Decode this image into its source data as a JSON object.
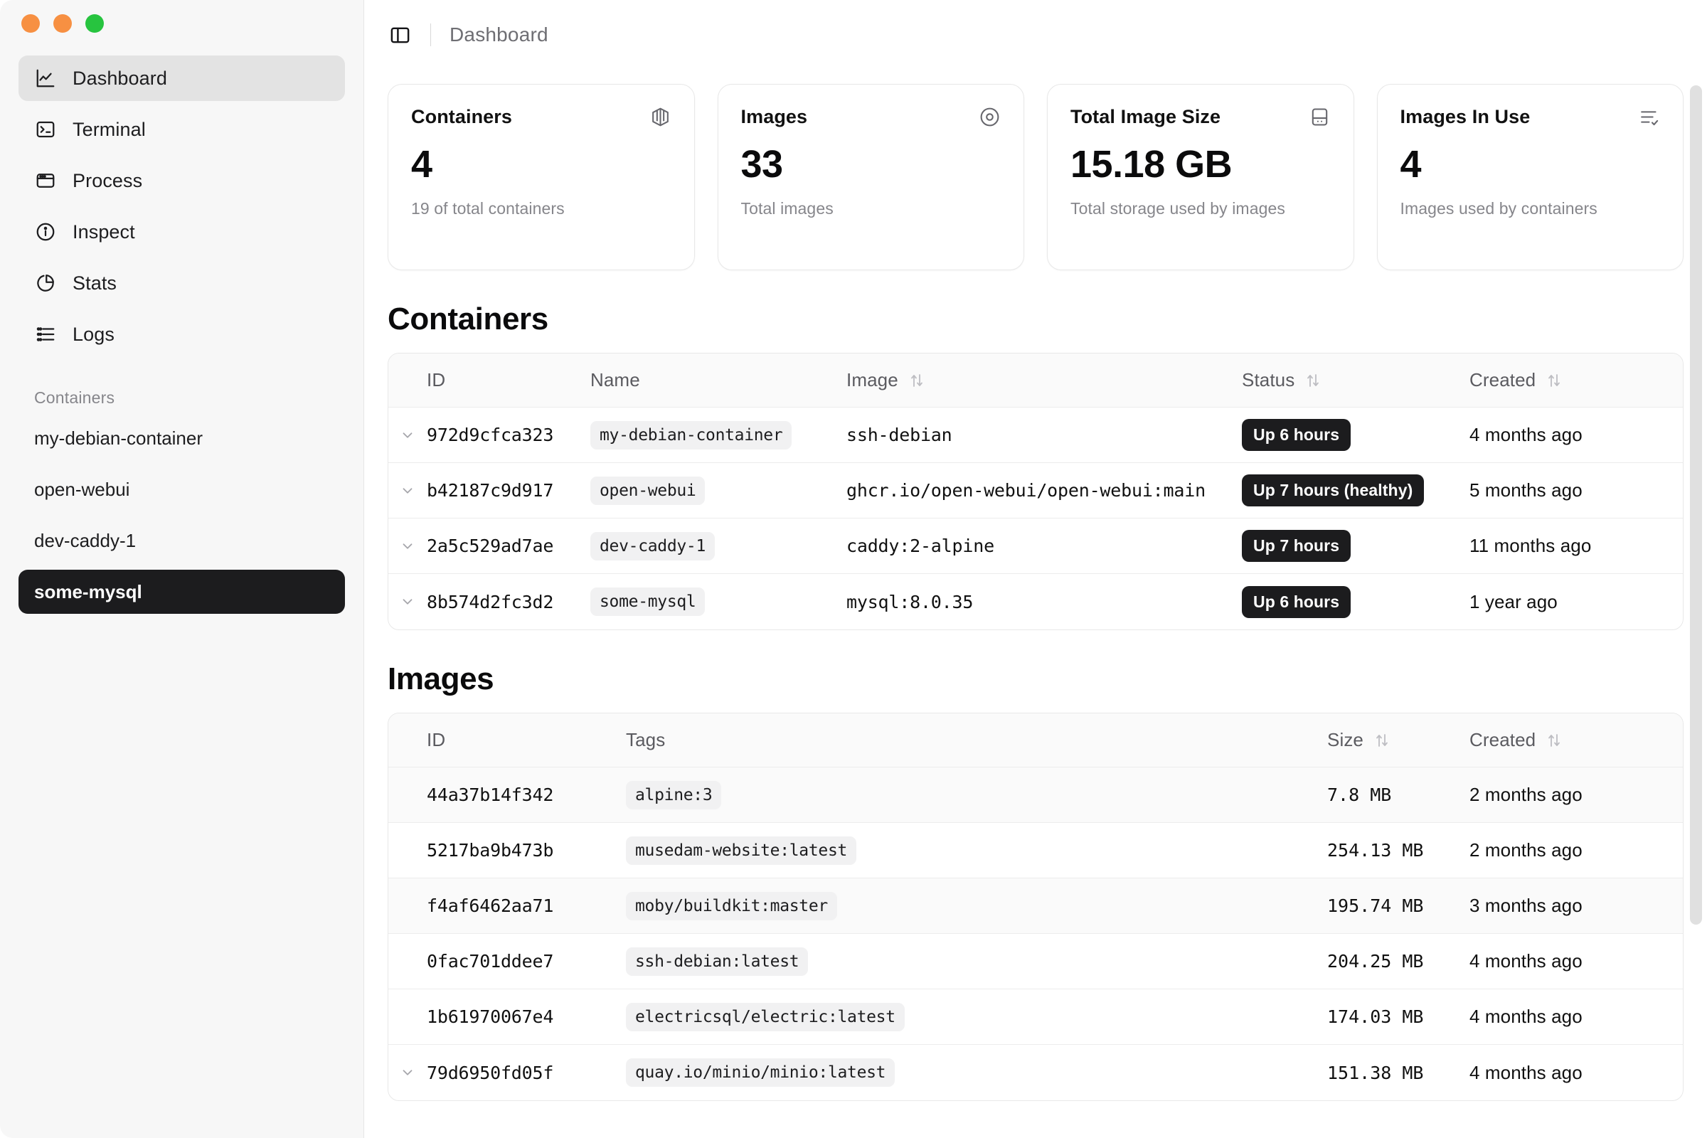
{
  "window": {
    "traffic_lights": [
      {
        "name": "close",
        "color": "#f79042"
      },
      {
        "name": "minimize",
        "color": "#f79042"
      },
      {
        "name": "maximize",
        "color": "#27c43f"
      }
    ]
  },
  "sidebar": {
    "nav": [
      {
        "label": "Dashboard",
        "icon": "chart-line-icon",
        "active": true
      },
      {
        "label": "Terminal",
        "icon": "terminal-icon",
        "active": false
      },
      {
        "label": "Process",
        "icon": "window-icon",
        "active": false
      },
      {
        "label": "Inspect",
        "icon": "info-circle-icon",
        "active": false
      },
      {
        "label": "Stats",
        "icon": "pie-chart-icon",
        "active": false
      },
      {
        "label": "Logs",
        "icon": "list-icon",
        "active": false
      }
    ],
    "section_label": "Containers",
    "containers": [
      {
        "label": "my-debian-container",
        "selected": false
      },
      {
        "label": "open-webui",
        "selected": false
      },
      {
        "label": "dev-caddy-1",
        "selected": false
      },
      {
        "label": "some-mysql",
        "selected": true
      }
    ]
  },
  "topbar": {
    "toggle_icon": "sidebar-toggle-icon",
    "breadcrumb": "Dashboard"
  },
  "cards": [
    {
      "title": "Containers",
      "icon": "box-3d-icon",
      "value": "4",
      "subtitle": "19 of total containers"
    },
    {
      "title": "Images",
      "icon": "disc-icon",
      "value": "33",
      "subtitle": "Total images"
    },
    {
      "title": "Total Image Size",
      "icon": "hard-drive-icon",
      "value": "15.18 GB",
      "subtitle": "Total storage used by images"
    },
    {
      "title": "Images In Use",
      "icon": "list-check-icon",
      "value": "4",
      "subtitle": "Images used by containers"
    }
  ],
  "containers_section": {
    "heading": "Containers",
    "columns": [
      "ID",
      "Name",
      "Image",
      "Status",
      "Created"
    ],
    "sortable": [
      false,
      false,
      true,
      true,
      true
    ],
    "rows": [
      {
        "id": "972d9cfca323",
        "name": "my-debian-container",
        "image": "ssh-debian",
        "status": "Up 6 hours",
        "created": "4 months ago",
        "expandable": true
      },
      {
        "id": "b42187c9d917",
        "name": "open-webui",
        "image": "ghcr.io/open-webui/open-webui:main",
        "status": "Up 7 hours (healthy)",
        "created": "5 months ago",
        "expandable": true
      },
      {
        "id": "2a5c529ad7ae",
        "name": "dev-caddy-1",
        "image": "caddy:2-alpine",
        "status": "Up 7 hours",
        "created": "11 months ago",
        "expandable": true
      },
      {
        "id": "8b574d2fc3d2",
        "name": "some-mysql",
        "image": "mysql:8.0.35",
        "status": "Up 6 hours",
        "created": "1 year ago",
        "expandable": true
      }
    ]
  },
  "images_section": {
    "heading": "Images",
    "columns": [
      "ID",
      "Tags",
      "Size",
      "Created"
    ],
    "sortable": [
      false,
      false,
      true,
      true
    ],
    "rows": [
      {
        "id": "44a37b14f342",
        "tag": "alpine:3",
        "size": "7.8 MB",
        "created": "2 months ago",
        "expandable": false
      },
      {
        "id": "5217ba9b473b",
        "tag": "musedam-website:latest",
        "size": "254.13 MB",
        "created": "2 months ago",
        "expandable": false
      },
      {
        "id": "f4af6462aa71",
        "tag": "moby/buildkit:master",
        "size": "195.74 MB",
        "created": "3 months ago",
        "expandable": false
      },
      {
        "id": "0fac701ddee7",
        "tag": "ssh-debian:latest",
        "size": "204.25 MB",
        "created": "4 months ago",
        "expandable": false
      },
      {
        "id": "1b61970067e4",
        "tag": "electricsql/electric:latest",
        "size": "174.03 MB",
        "created": "4 months ago",
        "expandable": false
      },
      {
        "id": "79d6950fd05f",
        "tag": "quay.io/minio/minio:latest",
        "size": "151.38 MB",
        "created": "4 months ago",
        "expandable": true
      }
    ]
  },
  "colors": {
    "sidebar_bg": "#f7f7f7",
    "selected_bg": "#1c1c1e",
    "badge_bg": "#1c1c1e",
    "accent_green": "#27c43f",
    "accent_orange": "#f79042"
  }
}
